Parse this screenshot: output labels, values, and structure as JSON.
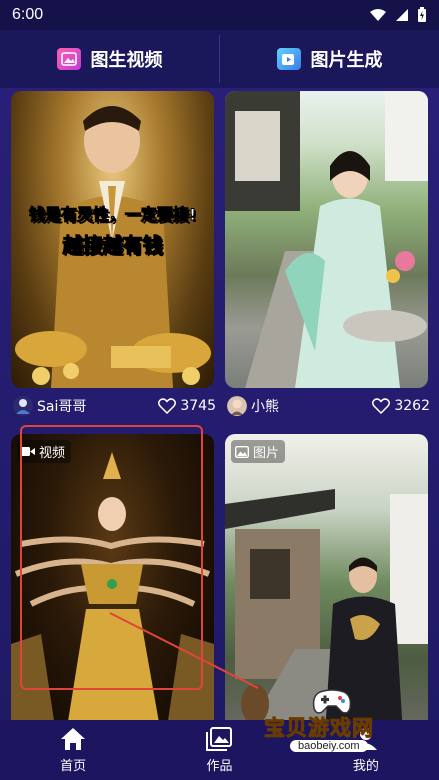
{
  "status_bar": {
    "time": "6:00"
  },
  "top_tabs": [
    {
      "label": "图生视频",
      "icon": "image-video-icon"
    },
    {
      "label": "图片生成",
      "icon": "image-generate-icon"
    }
  ],
  "cards": [
    {
      "author": "Sai哥哥",
      "likes": "3745",
      "overlay_line1": "钱是有灵性，一定要接!",
      "overlay_line2": "越接越有钱"
    },
    {
      "author": "小熊",
      "likes": "3262"
    },
    {
      "badge": "视频"
    },
    {
      "badge": "图片"
    }
  ],
  "bottom_nav": [
    {
      "label": "首页",
      "icon": "home-icon"
    },
    {
      "label": "作品",
      "icon": "gallery-icon"
    },
    {
      "label": "我的",
      "icon": "profile-icon"
    }
  ],
  "watermark": {
    "title": "宝贝游戏网",
    "url": "baobeiy.com"
  },
  "colors": {
    "background": "#1c1560",
    "highlight_box": "#e0453a",
    "accent_gold": "#ffd84a"
  }
}
